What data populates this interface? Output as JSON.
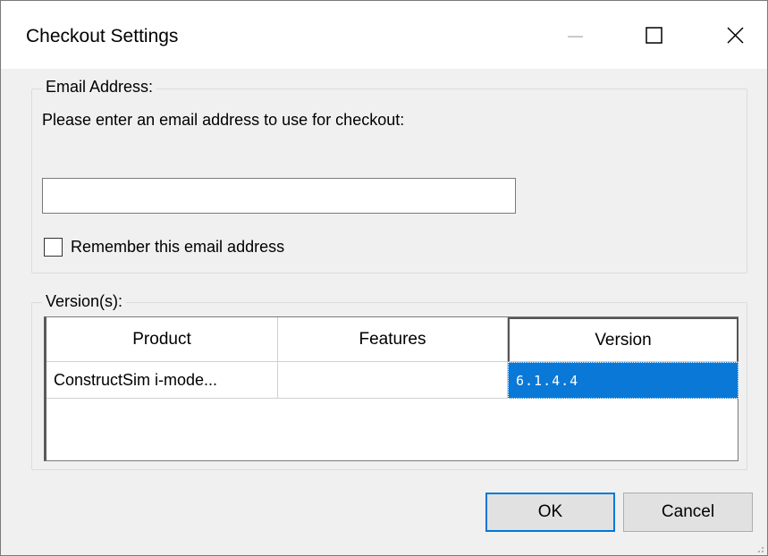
{
  "window": {
    "title": "Checkout Settings"
  },
  "titlebar_buttons": {
    "minimize": "minimize-icon",
    "maximize": "maximize-icon",
    "close": "close-icon"
  },
  "email_group": {
    "label": "Email Address:",
    "prompt": "Please enter an email address to use for checkout:",
    "input_value": "",
    "remember_label": "Remember this email address",
    "remember_checked": false
  },
  "versions_group": {
    "label": "Version(s):",
    "columns": [
      "Product",
      "Features",
      "Version"
    ],
    "rows": [
      {
        "product": "ConstructSim i-mode...",
        "features": "",
        "version": "6.1.4.4"
      }
    ]
  },
  "buttons": {
    "ok": "OK",
    "cancel": "Cancel"
  },
  "colors": {
    "selection": "#0a78d7",
    "focus_border": "#0078d7"
  }
}
